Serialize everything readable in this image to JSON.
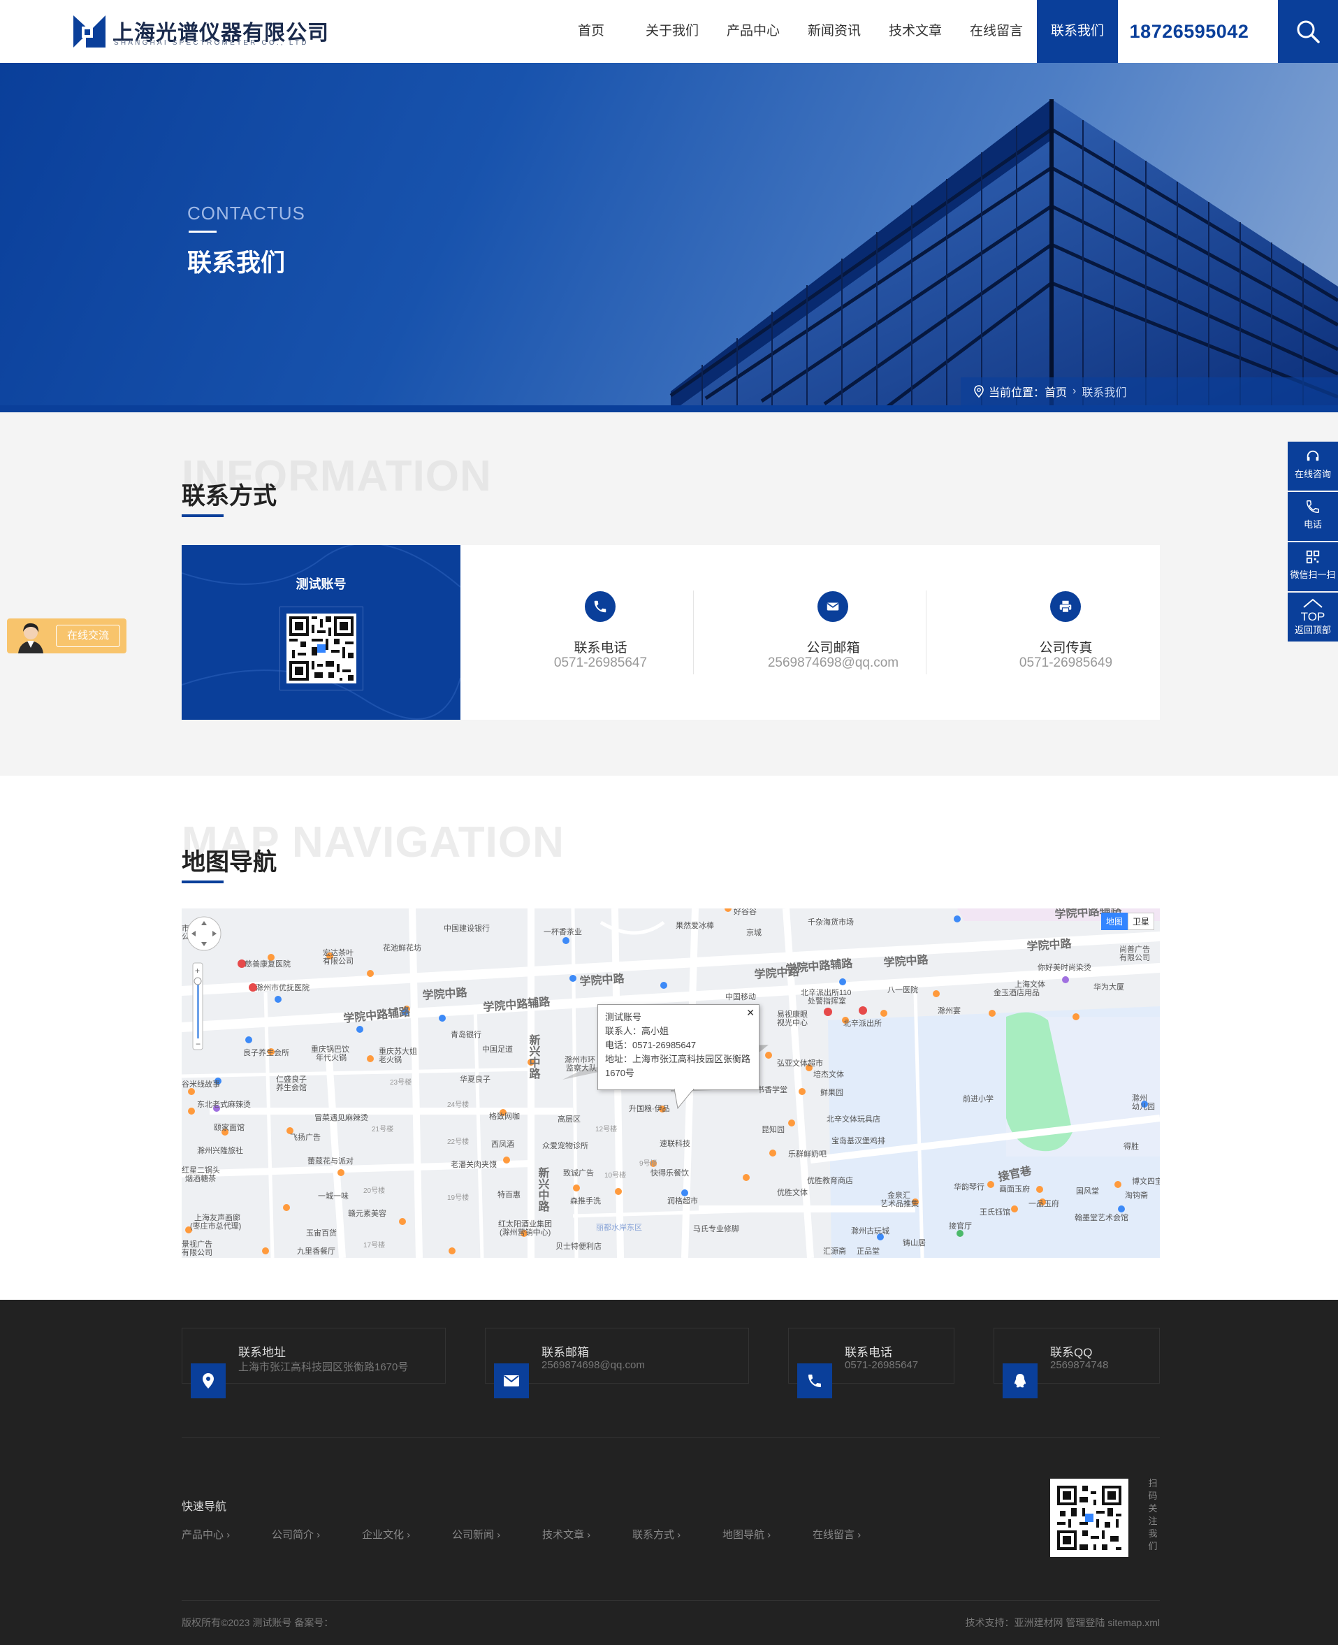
{
  "header": {
    "logo_cn": "上海光谱仪器有限公司",
    "logo_en": "SHANGHAI SPECTROMETER CO., LTD",
    "nav": [
      "首页",
      "关于我们",
      "产品中心",
      "新闻资讯",
      "技术文章",
      "在线留言",
      "联系我们"
    ],
    "active_nav": "联系我们",
    "hotline": "18726595042"
  },
  "banner": {
    "en": "CONTACTUS",
    "cn": "联系我们",
    "breadcrumb": {
      "label": "当前位置：",
      "home": "首页",
      "current": "联系我们"
    }
  },
  "info": {
    "ghost": "INFORMATION",
    "title": "联系方式",
    "qr_title": "测试账号",
    "items": [
      {
        "label": "联系电话",
        "value": "0571-26985647",
        "icon": "phone-icon"
      },
      {
        "label": "公司邮箱",
        "value": "2569874698@qq.com",
        "icon": "mail-icon"
      },
      {
        "label": "公司传真",
        "value": "0571-26985649",
        "icon": "fax-icon"
      }
    ]
  },
  "map_section": {
    "ghost": "MAP NAVIGATION",
    "title": "地图导航",
    "map_types": [
      "地图",
      "卫星"
    ],
    "popup": {
      "name": "测试账号",
      "contact": "联系人：高小姐",
      "phone": "电话：0571-26985647",
      "address": "地址：上海市张江高科技园区张衡路1670号"
    },
    "labels": {
      "roads": [
        "学院中路",
        "学院中路辅路",
        "学院中路",
        "学院中路辅路",
        "学院中路",
        "学院中路",
        "学院中路辅路",
        "学院中路",
        "新兴中路",
        "新兴中路",
        "接官巷"
      ],
      "pois": [
        "中国建设银行",
        "一杯香茶业",
        "果然爱冰棒",
        "好谷谷",
        "千杂海货市场",
        "宏达茶叶有限公司",
        "花池鲜花坊",
        "慈善康复医院",
        "滁州市优抚医院",
        "京城",
        "中国移动",
        "北辛派出所110处警指挥室",
        "八一医院",
        "你好美时尚染烫",
        "尚善广告有限公司",
        "上海文体",
        "华为大厦",
        "金玉酒店用品",
        "滁州宴",
        "易视康眼视光中心",
        "北辛派出所",
        "良子养生会所",
        "重庆锅巴饮年代火锅",
        "重庆苏大姐老火锅",
        "青岛银行",
        "中国足道",
        "滁州市环监察大队",
        "弘亚文体超市",
        "培杰文体",
        "书香学堂",
        "鲜果园",
        "北辛文体玩具店",
        "仁盛良子养生会馆",
        "华夏良子",
        "谷米线故事",
        "东北老式麻辣烫",
        "冒菜遇见麻辣烫",
        "格致网咖",
        "高层区",
        "升国粮·伊品",
        "前进小学",
        "滁州幼儿园",
        "颐家面馆",
        "滁州兴隆旅社",
        "飞扬广告",
        "蕾蔻花与派对",
        "西凤酒",
        "众爱宠物诊所",
        "速联科技",
        "昆知园",
        "宝岛基汉堡鸡排",
        "乐群鲜奶吧",
        "得胜",
        "红星二锅头烟酒糖茶",
        "老潘关肉夹馍",
        "致诚广告",
        "快得乐餐饮",
        "优胜教育商店",
        "优胜文体",
        "华韵琴行",
        "画面玉府",
        "国风堂",
        "博文四宝",
        "淘钩斋",
        "一城一味",
        "赣元素美容",
        "特百惠",
        "森推手洗",
        "润格超市",
        "金泉汇艺术品推集",
        "王氏钰馆",
        "一品玉府",
        "翰墨堂艺术会馆",
        "上海友声画廊(枣庄市总代理)",
        "玉宙百货",
        "红太阳酒业集团(滁州营销中心)",
        "马氏专业修脚",
        "滁州古玩城",
        "接官厅",
        "九里香餐厅",
        "贝士特便利店",
        "汇源斋",
        "正品堂",
        "铸山居",
        "广视广告有限公司",
        "丽都水岸东区"
      ]
    }
  },
  "footer": {
    "boxes": [
      {
        "label": "联系地址",
        "value": "上海市张江高科技园区张衡路1670号",
        "icon": "location-icon"
      },
      {
        "label": "联系邮箱",
        "value": "2569874698@qq.com",
        "icon": "mail-icon"
      },
      {
        "label": "联系电话",
        "value": "0571-26985647",
        "icon": "phone-icon"
      },
      {
        "label": "联系QQ",
        "value": "2569874748",
        "icon": "qq-icon"
      }
    ],
    "quick_nav_title": "快速导航",
    "quick_nav": [
      "产品中心",
      "公司简介",
      "企业文化",
      "公司新闻",
      "技术文章",
      "联系方式",
      "地图导航",
      "在线留言"
    ],
    "qr_text": "扫码关注我们",
    "copyright": "版权所有©2023 测试账号   备案号：",
    "support": "技术支持：亚洲建材网   管理登陆   sitemap.xml"
  },
  "side_bar": [
    {
      "label": "在线咨询",
      "icon": "headset-icon"
    },
    {
      "label": "电话",
      "icon": "phone-icon"
    },
    {
      "label": "微信扫一扫",
      "icon": "qrcode-icon"
    },
    {
      "label": "返回顶部",
      "top": "TOP",
      "icon": "arrow-up-icon"
    }
  ],
  "chat_widget": {
    "label": "在线交流"
  },
  "colors": {
    "brand": "#0a3f9a",
    "footer_bg": "#222222",
    "section_bg": "#f4f4f4"
  }
}
